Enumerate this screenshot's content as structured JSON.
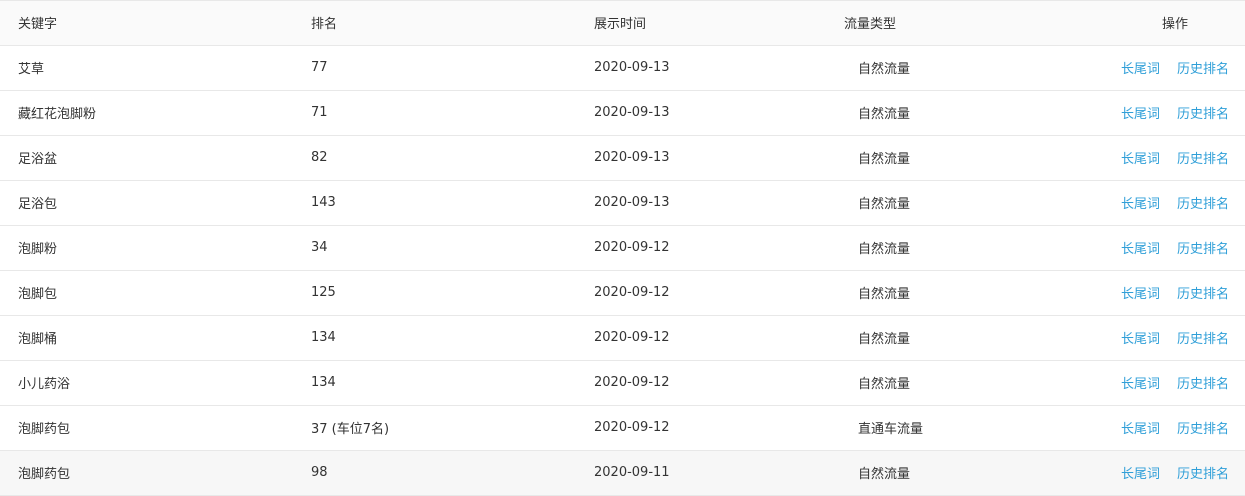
{
  "table": {
    "headers": {
      "keyword": "关键字",
      "rank": "排名",
      "date": "展示时间",
      "traffic_type": "流量类型",
      "actions": "操作"
    },
    "action_labels": {
      "long_tail": "长尾词",
      "history": "历史排名"
    },
    "rows": [
      {
        "keyword": "艾草",
        "rank": "77",
        "date": "2020-09-13",
        "traffic_type": "自然流量"
      },
      {
        "keyword": "藏红花泡脚粉",
        "rank": "71",
        "date": "2020-09-13",
        "traffic_type": "自然流量"
      },
      {
        "keyword": "足浴盆",
        "rank": "82",
        "date": "2020-09-13",
        "traffic_type": "自然流量"
      },
      {
        "keyword": "足浴包",
        "rank": "143",
        "date": "2020-09-13",
        "traffic_type": "自然流量"
      },
      {
        "keyword": "泡脚粉",
        "rank": "34",
        "date": "2020-09-12",
        "traffic_type": "自然流量"
      },
      {
        "keyword": "泡脚包",
        "rank": "125",
        "date": "2020-09-12",
        "traffic_type": "自然流量"
      },
      {
        "keyword": "泡脚桶",
        "rank": "134",
        "date": "2020-09-12",
        "traffic_type": "自然流量"
      },
      {
        "keyword": "小儿药浴",
        "rank": "134",
        "date": "2020-09-12",
        "traffic_type": "自然流量"
      },
      {
        "keyword": "泡脚药包",
        "rank": "37 (车位7名)",
        "date": "2020-09-12",
        "traffic_type": "直通车流量"
      },
      {
        "keyword": "泡脚药包",
        "rank": "98",
        "date": "2020-09-11",
        "traffic_type": "自然流量"
      }
    ]
  },
  "colors": {
    "link": "#2f9fd8",
    "header_bg": "#fafafa",
    "border": "#e8e8e8",
    "text": "#333333"
  }
}
